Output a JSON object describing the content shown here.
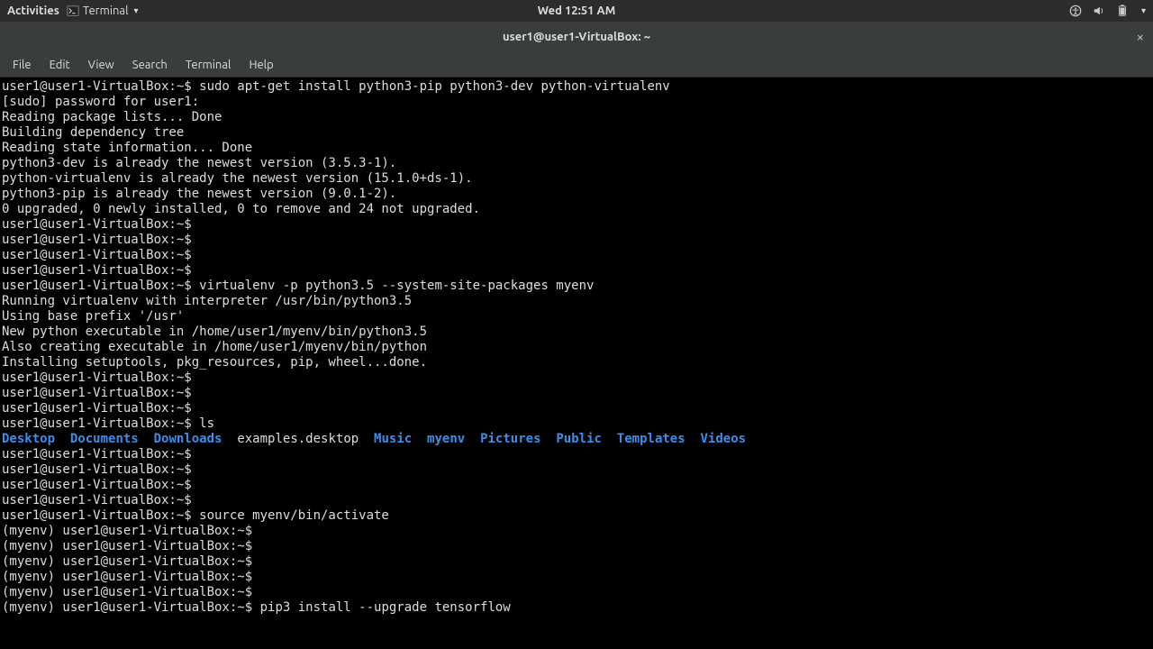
{
  "topbar": {
    "activities": "Activities",
    "app_name": "Terminal",
    "clock": "Wed 12:51 AM"
  },
  "titlebar": {
    "title": "user1@user1-VirtualBox: ~",
    "close": "×"
  },
  "menubar": {
    "items": [
      "File",
      "Edit",
      "View",
      "Search",
      "Terminal",
      "Help"
    ]
  },
  "terminal": {
    "prompt": "user1@user1-VirtualBox:~$",
    "prompt_venv": "(myenv) user1@user1-VirtualBox:~$",
    "cmd_apt": "sudo apt-get install python3-pip python3-dev python-virtualenv",
    "out_sudo": "[sudo] password for user1:",
    "out_read1": "Reading package lists... Done",
    "out_build": "Building dependency tree",
    "out_read2": "Reading state information... Done",
    "out_dev": "python3-dev is already the newest version (3.5.3-1).",
    "out_venv": "python-virtualenv is already the newest version (15.1.0+ds-1).",
    "out_pip": "python3-pip is already the newest version (9.0.1-2).",
    "out_upgrade": "0 upgraded, 0 newly installed, 0 to remove and 24 not upgraded.",
    "cmd_virtualenv": "virtualenv -p python3.5 --system-site-packages myenv",
    "out_running": "Running virtualenv with interpreter /usr/bin/python3.5",
    "out_prefix": "Using base prefix '/usr'",
    "out_newexec": "New python executable in /home/user1/myenv/bin/python3.5",
    "out_alsoexec": "Also creating executable in /home/user1/myenv/bin/python",
    "out_install": "Installing setuptools, pkg_resources, pip, wheel...done.",
    "cmd_ls": "ls",
    "ls_dirs": [
      "Desktop",
      "Documents",
      "Downloads"
    ],
    "ls_file": "examples.desktop",
    "ls_dirs2": [
      "Music",
      "myenv",
      "Pictures",
      "Public",
      "Templates",
      "Videos"
    ],
    "cmd_activate": "source myenv/bin/activate",
    "cmd_pip_install": "pip3 install --upgrade tensorflow"
  }
}
